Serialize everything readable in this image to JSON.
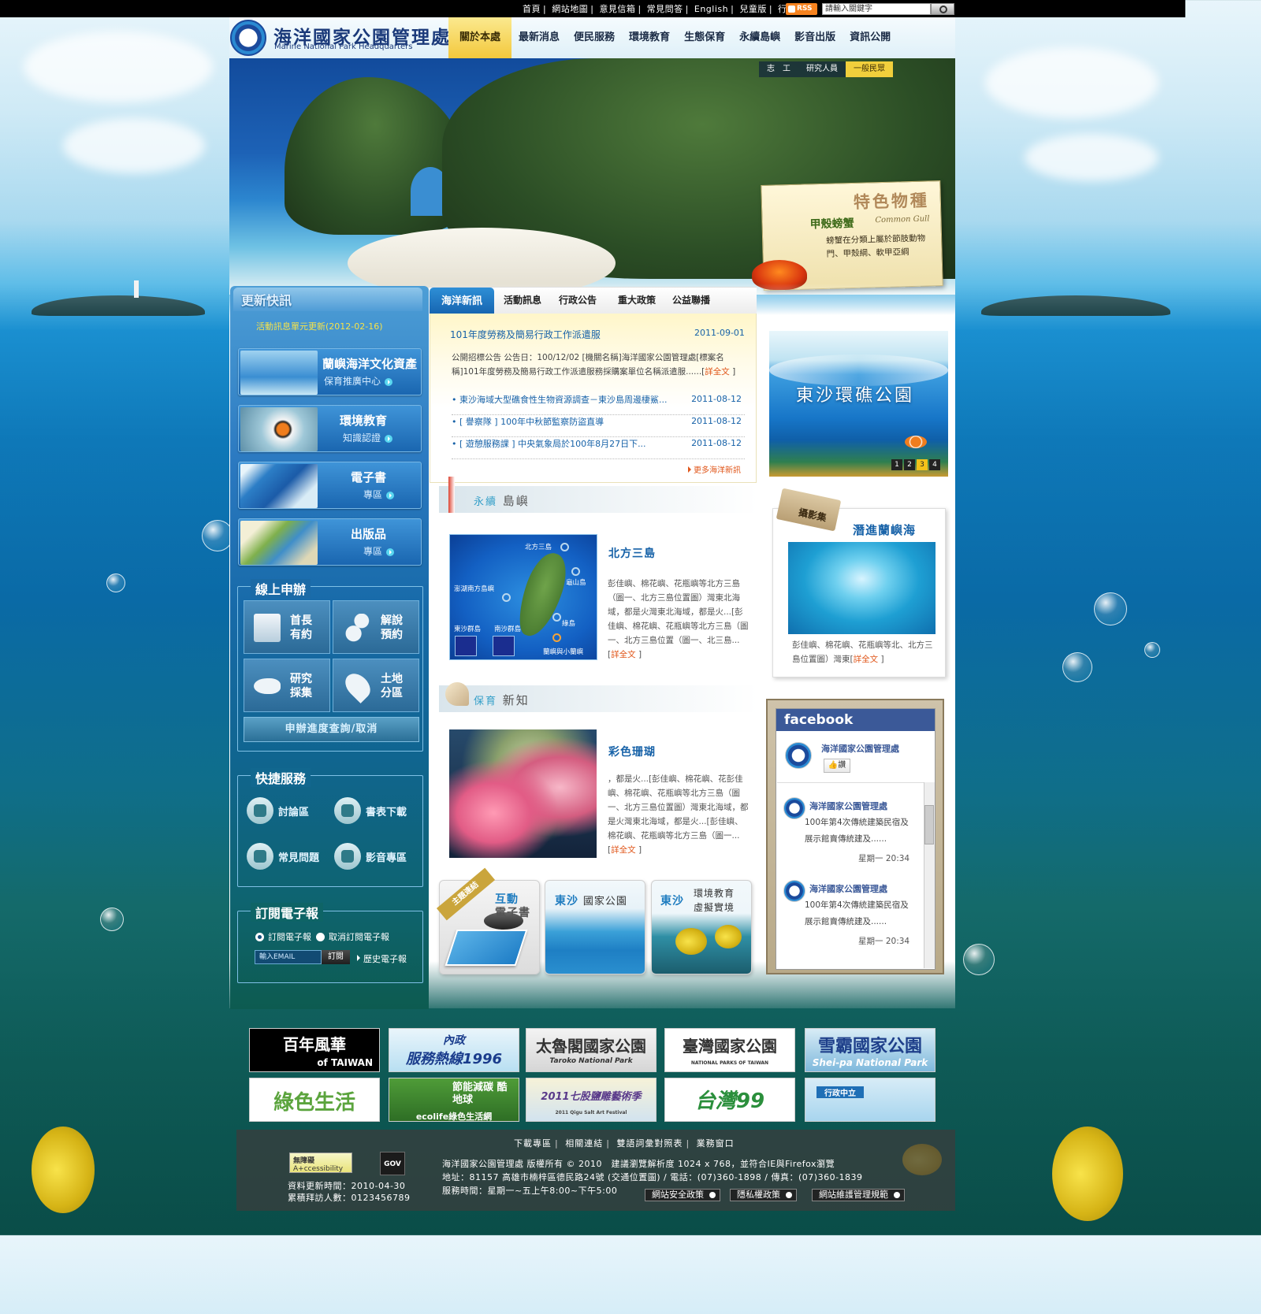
{
  "topbar": {
    "links": [
      "首頁",
      "網站地圖",
      "意見信箱",
      "常見問答",
      "English",
      "兒童版",
      "行動版"
    ],
    "rss": "RSS",
    "search_placeholder": "請輸入關鍵字"
  },
  "header": {
    "logo_title": "海洋國家公園管理處",
    "logo_sub": "Marine National Park Headquarters",
    "nav": [
      "關於本處",
      "最新消息",
      "便民服務",
      "環境教育",
      "生態保育",
      "永續島嶼",
      "影音出版",
      "資訊公開"
    ]
  },
  "banner": {
    "roles": [
      "志　工",
      "研究人員",
      "一般民眾"
    ],
    "feature_title": "特色物種",
    "feature_name": "甲殼螃蟹",
    "feature_en": "Common Gull",
    "feature_desc": "螃蟹在分類上屬於節肢動物門、甲殼綱、軟甲亞綱"
  },
  "sidebar": {
    "update_title": "更新快訊",
    "update_link": "活動訊息單元更新(2012-02-16)",
    "promos": [
      {
        "t1": "蘭嶼海洋文化資產",
        "t2": "保育推廣中心"
      },
      {
        "t1": "環境教育",
        "t2": "知識認證"
      },
      {
        "t1": "電子書",
        "t2": "專區"
      },
      {
        "t1": "出版品",
        "t2": "專區"
      }
    ],
    "online_title": "線上申辦",
    "online_buttons": [
      "首長\n有約",
      "解說\n預約",
      "研究\n採集",
      "土地\n分區"
    ],
    "progress": "申辦進度查詢/取消",
    "quick_title": "快捷服務",
    "quick": [
      "討論區",
      "書表下載",
      "常見問題",
      "影音專區"
    ],
    "newsletter_title": "訂閱電子報",
    "subscribe": "訂閱電子報",
    "unsubscribe": "取消訂閱電子報",
    "email_placeholder": "輸入EMAIL",
    "email_btn": "訂閱",
    "history": "歷史電子報"
  },
  "news": {
    "tabs": [
      "海洋新訊",
      "活動訊息",
      "行政公告",
      "重大政策",
      "公益聯播"
    ],
    "headline": "101年度勞務及簡易行政工作派遣服",
    "headline_date": "2011-09-01",
    "lead": "公開招標公告 公告日：100/12/02 [機關名稱]海洋國家公園管理處[標案名稱]101年度勞務及簡易行政工作派遣服務採購案單位名稱派遣服......",
    "lead_more": "詳全文",
    "items": [
      {
        "title": "東沙海域大型礁食性生物資源調查－東沙島周邊棲鯊...",
        "date": "2011-08-12"
      },
      {
        "title": "[ 譽察隊 ] 100年中秋節監察防盜直導",
        "date": "2011-08-12"
      },
      {
        "title": "[ 遊憩服務課 ] 中央氣象局於100年8月27日下...",
        "date": "2011-08-12"
      }
    ],
    "more": "更多海洋新訊"
  },
  "carousel": {
    "title": "東沙環礁公園",
    "pages": [
      "1",
      "2",
      "3",
      "4"
    ],
    "active": 2
  },
  "islands": {
    "section_title_a": "永續",
    "section_title_b": "島嶼",
    "map_labels": [
      "北方三島",
      "澎湖南方島嶼",
      "龜山島",
      "綠島",
      "東沙群島",
      "南沙群島",
      "蘭嶼與小蘭嶼"
    ],
    "title": "北方三島",
    "body": "彭佳嶼、棉花嶼、花瓶嶼等北方三島（圖一、北方三島位置圖）灣東北海域，都是火灣東北海域，都是火...[彭佳嶼、棉花嶼、花瓶嶼等北方三島（圖一、北方三島位置（圖一、北三島...",
    "more": "詳全文"
  },
  "album": {
    "tag": "攝影集",
    "title": "潛進蘭嶼海",
    "body": "彭佳嶼、棉花嶼、花瓶嶼等北、北方三島位置圖）灣東",
    "more": "詳全文"
  },
  "conservation": {
    "section_title_a": "保育",
    "section_title_b": "新知",
    "title": "彩色珊瑚",
    "body": "，都是火...[彭佳嶼、棉花嶼、花彭佳嶼、棉花嶼、花瓶嶼等北方三島（圖一、北方三島位置圖）灣東北海域，都是火灣東北海域，都是火...[彭佳嶼、棉花嶼、花瓶嶼等北方三島（圖一...",
    "more": "詳全文"
  },
  "facebook": {
    "brand": "facebook",
    "page_name": "海洋國家公園管理處",
    "like": "讚",
    "posts": [
      {
        "name": "海洋國家公園管理處",
        "text": "100年第4次傳統建築民宿及展示館賣傳統建及......",
        "time": "星期一 20:34"
      },
      {
        "name": "海洋國家公園管理處",
        "text": "100年第4次傳統建築民宿及展示館賣傳統建及......",
        "time": "星期一 20:34"
      }
    ]
  },
  "thumbs": {
    "ribbon": "主題連結",
    "t1a": "互動",
    "t1b": "電子書",
    "t2a": "東沙",
    "t2b": "國家公園",
    "t3a": "東沙",
    "t3b": "環境教育",
    "t3c": "虛擬實境"
  },
  "partners": [
    {
      "line1": "百年風華",
      "line2": "of TAIWAN"
    },
    {
      "line1": "內政",
      "line2": "服務熱線1996"
    },
    {
      "line1": "太魯閣國家公園",
      "line2": "Taroko National Park"
    },
    {
      "line1": "臺灣國家公園",
      "line2": "NATIONAL PARKS OF TAIWAN"
    },
    {
      "line1": "雪霸國家公園",
      "line2": "Shei-pa National Park"
    },
    {
      "line1": "綠色生活",
      "line2": ""
    },
    {
      "line1": "節能減碳 酷地球",
      "line2": "ecolife綠色生活網"
    },
    {
      "line1": "2011七股鹽雕藝術季",
      "line2": "2011 Qigu Salt Art Festival"
    },
    {
      "line1": "台灣99",
      "line2": ""
    },
    {
      "line1": "行政中立",
      "line2": ""
    }
  ],
  "footer": {
    "links": [
      "下載專區",
      "相關連結",
      "雙語詞彙對照表",
      "業務窗口"
    ],
    "line1": "海洋國家公園管理處 版權所有 © 2010　建議瀏覽解析度 1024 x 768，並符合IE與Firefox瀏覽",
    "line2": "地址：81157 高雄市楠梓區德民路24號 (交通位置圖)  /  電話：(07)360-1898  /  傳真：(07)360-1839",
    "line3": "服務時間：星期一~五上午8:00~下午5:00",
    "updated": "資料更新時間：2010-04-30",
    "visits": "累積拜訪人數：0123456789",
    "access": "無障礙",
    "access_sub": "A+ccessibility",
    "gov": "GOV",
    "buttons": [
      "網站安全政策",
      "隱私權政策",
      "網站維護管理規範"
    ]
  }
}
